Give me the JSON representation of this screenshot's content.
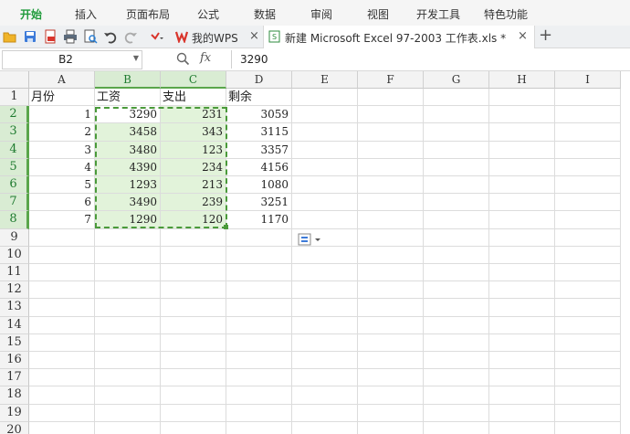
{
  "menu": {
    "items": [
      {
        "label": "开始",
        "active": true
      },
      {
        "label": "插入"
      },
      {
        "label": "页面布局"
      },
      {
        "label": "公式"
      },
      {
        "label": "数据"
      },
      {
        "label": "审阅"
      },
      {
        "label": "视图"
      },
      {
        "label": "开发工具"
      },
      {
        "label": "特色功能"
      }
    ]
  },
  "toolbar": {
    "icons": [
      "open-folder-icon",
      "save-icon",
      "export-pdf-icon",
      "print-icon",
      "print-preview-icon",
      "undo-icon",
      "redo-icon",
      "more-dropdown-icon"
    ]
  },
  "tabs": [
    {
      "label": "我的WPS",
      "close": "×"
    },
    {
      "label": "新建 Microsoft Excel 97-2003 工作表.xls *",
      "close": "×"
    }
  ],
  "new_tab": "+",
  "formula_bar": {
    "name_box": "B2",
    "fx_label": "fx",
    "value": "3290"
  },
  "sheet": {
    "columns": [
      "A",
      "B",
      "C",
      "D",
      "E",
      "F",
      "G",
      "H",
      "I"
    ],
    "rows": [
      "1",
      "2",
      "3",
      "4",
      "5",
      "6",
      "7",
      "8",
      "9",
      "10",
      "11",
      "12",
      "13",
      "14",
      "15",
      "16",
      "17",
      "18",
      "19",
      "20"
    ],
    "selected_columns": [
      "B",
      "C"
    ],
    "selected_rows": [
      "2",
      "3",
      "4",
      "5",
      "6",
      "7",
      "8"
    ],
    "headers": [
      "月份",
      "工资",
      "支出",
      "剩余"
    ],
    "data": [
      [
        "1",
        "3290",
        "231",
        "3059"
      ],
      [
        "2",
        "3458",
        "343",
        "3115"
      ],
      [
        "3",
        "3480",
        "123",
        "3357"
      ],
      [
        "4",
        "4390",
        "234",
        "4156"
      ],
      [
        "5",
        "1293",
        "213",
        "1080"
      ],
      [
        "6",
        "3490",
        "239",
        "3251"
      ],
      [
        "7",
        "1290",
        "120",
        "1170"
      ]
    ]
  },
  "colors": {
    "accent_green": "#1e9a3a",
    "selection_fill": "#e2f3da",
    "selection_border": "#4a9a3a"
  }
}
